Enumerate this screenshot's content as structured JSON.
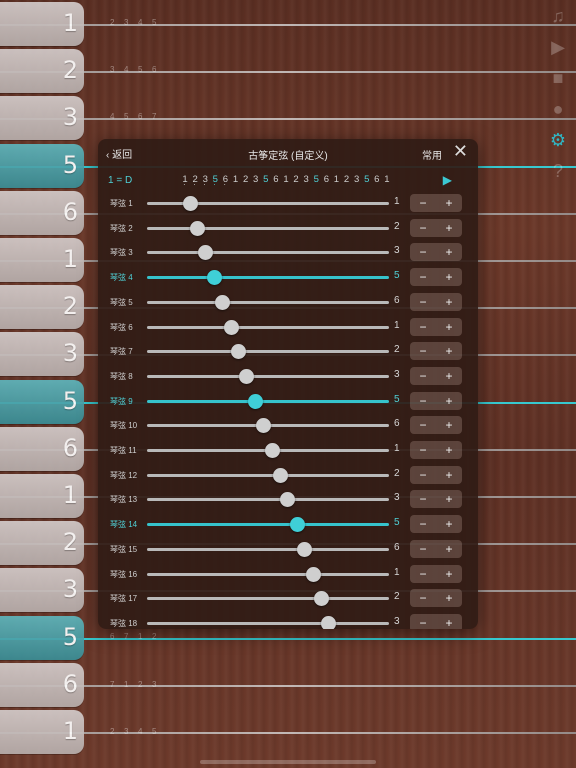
{
  "board": {
    "strings": [
      {
        "note": "1",
        "octave": "mid",
        "highlight": false
      },
      {
        "note": "2",
        "octave": "mid",
        "highlight": false
      },
      {
        "note": "3",
        "octave": "mid",
        "highlight": false
      },
      {
        "note": "5",
        "octave": "mid",
        "highlight": true
      },
      {
        "note": "6",
        "octave": "low",
        "highlight": false
      },
      {
        "note": "1",
        "octave": "low",
        "highlight": false
      },
      {
        "note": "2",
        "octave": "low",
        "highlight": false
      },
      {
        "note": "3",
        "octave": "low",
        "highlight": false
      },
      {
        "note": "5",
        "octave": "low",
        "highlight": true
      },
      {
        "note": "6",
        "octave": "low2",
        "highlight": false
      },
      {
        "note": "1",
        "octave": "low2",
        "highlight": false
      },
      {
        "note": "2",
        "octave": "low2",
        "highlight": false
      },
      {
        "note": "3",
        "octave": "low2",
        "highlight": false
      },
      {
        "note": "5",
        "octave": "low2",
        "highlight": true
      },
      {
        "note": "6",
        "octave": "low3",
        "highlight": false
      },
      {
        "note": "1",
        "octave": "low3",
        "highlight": false
      }
    ],
    "hint_notes": [
      [
        "2",
        "3",
        "4",
        "5"
      ],
      [
        "3",
        "4",
        "5",
        "6"
      ],
      [
        "4",
        "5",
        "6",
        "7"
      ],
      [
        "6",
        "7",
        "1",
        "2"
      ],
      [
        "7",
        "1",
        "2",
        "3"
      ],
      [
        "2",
        "3",
        "4",
        "5"
      ]
    ]
  },
  "toolbar": [
    "music-note-icon",
    "play-icon",
    "stop-icon",
    "record-icon",
    "gear-icon",
    "help-icon"
  ],
  "panel": {
    "back_label": "返回",
    "title": "古筝定弦 (自定义)",
    "common_label": "常用",
    "key_label": "1 = D",
    "scale": [
      "1",
      "2",
      "3",
      "5",
      "6",
      "1",
      "2",
      "3",
      "5",
      "6",
      "1",
      "2",
      "3",
      "5",
      "6",
      "1",
      "2",
      "3",
      "5",
      "6",
      "1"
    ],
    "rows": [
      {
        "label": "琴弦 1",
        "note": "1",
        "value": 0.18,
        "hl": false
      },
      {
        "label": "琴弦 2",
        "note": "2",
        "value": 0.21,
        "hl": false
      },
      {
        "label": "琴弦 3",
        "note": "3",
        "value": 0.24,
        "hl": false
      },
      {
        "label": "琴弦 4",
        "note": "5",
        "value": 0.28,
        "hl": true
      },
      {
        "label": "琴弦 5",
        "note": "6",
        "value": 0.31,
        "hl": false
      },
      {
        "label": "琴弦 6",
        "note": "1",
        "value": 0.35,
        "hl": false
      },
      {
        "label": "琴弦 7",
        "note": "2",
        "value": 0.38,
        "hl": false
      },
      {
        "label": "琴弦 8",
        "note": "3",
        "value": 0.41,
        "hl": false
      },
      {
        "label": "琴弦 9",
        "note": "5",
        "value": 0.45,
        "hl": true
      },
      {
        "label": "琴弦 10",
        "note": "6",
        "value": 0.48,
        "hl": false
      },
      {
        "label": "琴弦 11",
        "note": "1",
        "value": 0.52,
        "hl": false
      },
      {
        "label": "琴弦 12",
        "note": "2",
        "value": 0.55,
        "hl": false
      },
      {
        "label": "琴弦 13",
        "note": "3",
        "value": 0.58,
        "hl": false
      },
      {
        "label": "琴弦 14",
        "note": "5",
        "value": 0.62,
        "hl": true
      },
      {
        "label": "琴弦 15",
        "note": "6",
        "value": 0.65,
        "hl": false
      },
      {
        "label": "琴弦 16",
        "note": "1",
        "value": 0.69,
        "hl": false
      },
      {
        "label": "琴弦 17",
        "note": "2",
        "value": 0.72,
        "hl": false
      },
      {
        "label": "琴弦 18",
        "note": "3",
        "value": 0.75,
        "hl": false
      }
    ],
    "minus_label": "−",
    "plus_label": "+"
  },
  "colors": {
    "accent": "#3bc8d2",
    "wood": "#6b3829"
  }
}
